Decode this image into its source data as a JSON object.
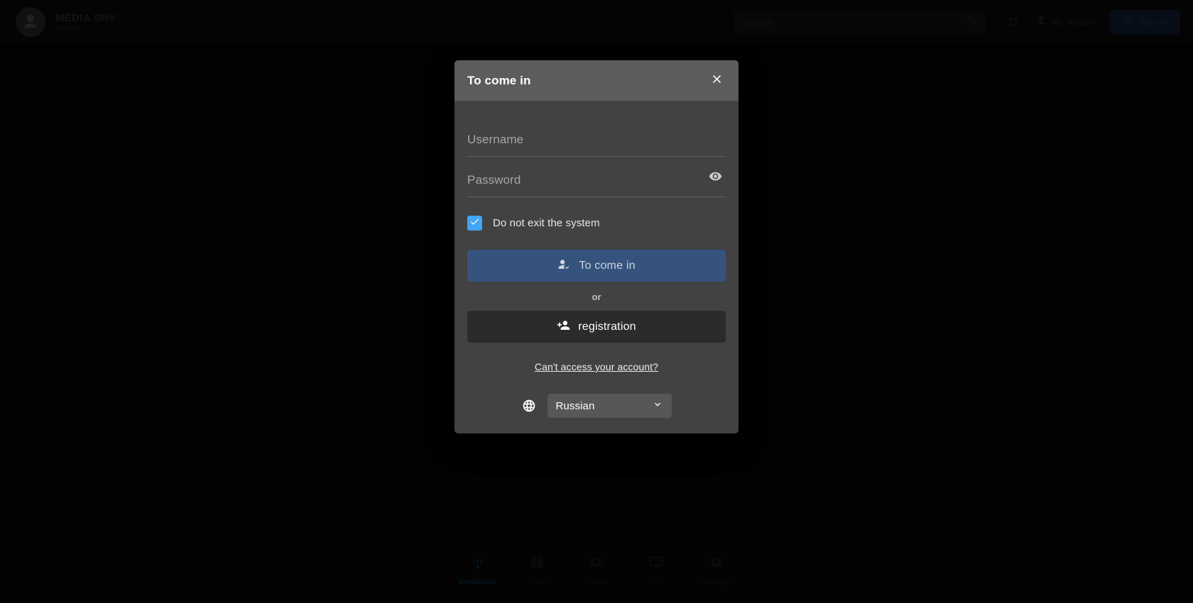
{
  "header": {
    "brand_title": "MEDIA SRV",
    "brand_sub": "PORTAL",
    "logo_icon": "user-avatar-icon",
    "search": {
      "placeholder": "Search",
      "icon": "search-icon"
    },
    "grid_icon": "apps-grid-icon",
    "user": {
      "name": "My account",
      "icon": "user-icon"
    },
    "cta": {
      "label": "Sign in",
      "icon": "login-icon"
    }
  },
  "bottom_nav": {
    "items": [
      {
        "label": "Broadcasts",
        "icon": "broadcast-icon",
        "active": true
      },
      {
        "label": "Films",
        "icon": "film-icon",
        "active": false
      },
      {
        "label": "Series",
        "icon": "series-icon",
        "active": false
      },
      {
        "label": "TV",
        "icon": "tv-icon",
        "active": false
      },
      {
        "label": "Settings",
        "icon": "settings-icon",
        "active": false
      }
    ]
  },
  "modal": {
    "title": "To come in",
    "close_icon": "close-icon",
    "username": {
      "placeholder": "Username",
      "value": ""
    },
    "password": {
      "placeholder": "Password",
      "value": "",
      "reveal_icon": "eye-icon"
    },
    "remember": {
      "label": "Do not exit the system",
      "checked": true,
      "icon": "check-icon"
    },
    "login_button": {
      "label": "To come in",
      "icon": "person-check-icon"
    },
    "divider_label": "or",
    "register_button": {
      "label": "registration",
      "icon": "person-add-icon"
    },
    "help_link": "Can't access your account?",
    "language": {
      "icon": "globe-icon",
      "selected": "Russian",
      "chevron_icon": "chevron-down-icon"
    }
  },
  "colors": {
    "accent_blue": "#42a5f5",
    "primary_button": "#35537d",
    "modal_header": "#5c5c5c",
    "modal_body": "#424242",
    "page_background": "#070708"
  }
}
